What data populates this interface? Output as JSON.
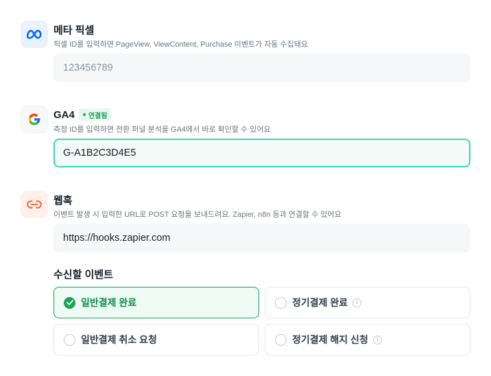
{
  "meta": {
    "title": "메타 픽셀",
    "description": "픽셀 ID를 입력하면 PageView, ViewContent, Purchase 이벤트가 자동 수집돼요",
    "input_placeholder": "123456789",
    "icon": "meta-logo-icon"
  },
  "ga4": {
    "title": "GA4",
    "badge": "연결됨",
    "description": "측정 ID를 입력하면 전환 퍼널 분석을 GA4에서 바로 확인할 수 있어요",
    "input_value": "G-A1B2C3D4E5",
    "icon": "google-logo-icon"
  },
  "webhook": {
    "title": "웹훅",
    "description": "이벤트 발생 시 입력한 URL로 POST 요청을 보내드려요. Zapier, n8n 등과 연결할 수 있어요",
    "input_value": "https://hooks.zapier.com",
    "icon": "link-icon"
  },
  "events": {
    "title": "수신할 이벤트",
    "options": [
      {
        "label": "일반결제 완료",
        "selected": true,
        "info": false
      },
      {
        "label": "정기결제 완료",
        "selected": false,
        "info": true
      },
      {
        "label": "일반결제 취소 요청",
        "selected": false,
        "info": false
      },
      {
        "label": "정기결제 해지 신청",
        "selected": false,
        "info": true
      }
    ]
  },
  "colors": {
    "accent_green": "#1aa15a",
    "active_border": "#34d9b1",
    "meta_blue": "#0866ff",
    "webhook_orange": "#f2653a"
  }
}
